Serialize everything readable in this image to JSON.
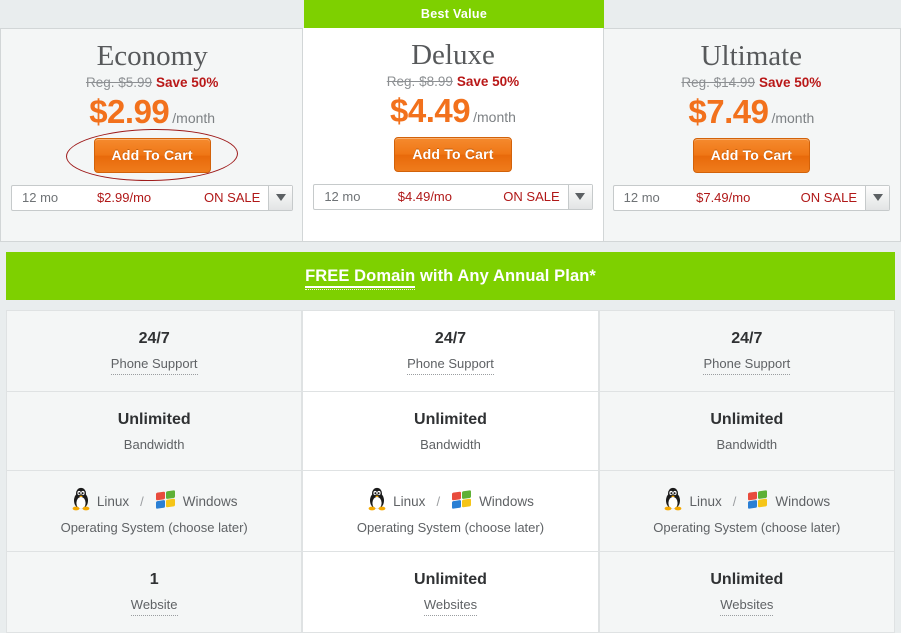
{
  "banner": {
    "best_value_label": "Best Value",
    "best_value_color": "#7ed000"
  },
  "promo": {
    "highlight": "FREE Domain",
    "rest": " with Any Annual Plan*",
    "background": "#7ed000"
  },
  "theme": {
    "page_background": "#e9edee",
    "card_background": "#f4f6f6",
    "featured_background": "#ffffff",
    "price_color": "#f2711c",
    "save_color": "#b91818",
    "cart_button_color": "#ef7615",
    "annotation_color": "#9e1b1b"
  },
  "annotation": {
    "shape": "ellipse",
    "target": "economy-add-to-cart-button"
  },
  "plans": [
    {
      "name": "Economy",
      "reg_label": "Reg. $5.99",
      "save_label": "Save 50%",
      "price": "$2.99",
      "period": "/month",
      "cart_label": "Add To Cart",
      "term": "12 mo",
      "rate": "$2.99/mo",
      "sale": "ON SALE",
      "featured": false
    },
    {
      "name": "Deluxe",
      "reg_label": "Reg. $8.99",
      "save_label": "Save 50%",
      "price": "$4.49",
      "period": "/month",
      "cart_label": "Add To Cart",
      "term": "12 mo",
      "rate": "$4.49/mo",
      "sale": "ON SALE",
      "featured": true
    },
    {
      "name": "Ultimate",
      "reg_label": "Reg. $14.99",
      "save_label": "Save 50%",
      "price": "$7.49",
      "period": "/month",
      "cart_label": "Add To Cart",
      "term": "12 mo",
      "rate": "$7.49/mo",
      "sale": "ON SALE",
      "featured": false
    }
  ],
  "features": [
    {
      "label": "Phone Support",
      "label_dotted": true,
      "values": [
        "24/7",
        "24/7",
        "24/7"
      ]
    },
    {
      "label": "Bandwidth",
      "label_dotted": false,
      "values": [
        "Unlimited",
        "Unlimited",
        "Unlimited"
      ]
    },
    {
      "label": "Operating System (choose later)",
      "label_dotted": false,
      "type": "os",
      "os_linux": "Linux",
      "os_separator": "/",
      "os_windows": "Windows",
      "values": [
        "",
        "",
        ""
      ]
    },
    {
      "label_per_column": [
        "Website",
        "Websites",
        "Websites"
      ],
      "label_dotted": true,
      "values": [
        "1",
        "Unlimited",
        "Unlimited"
      ]
    }
  ]
}
